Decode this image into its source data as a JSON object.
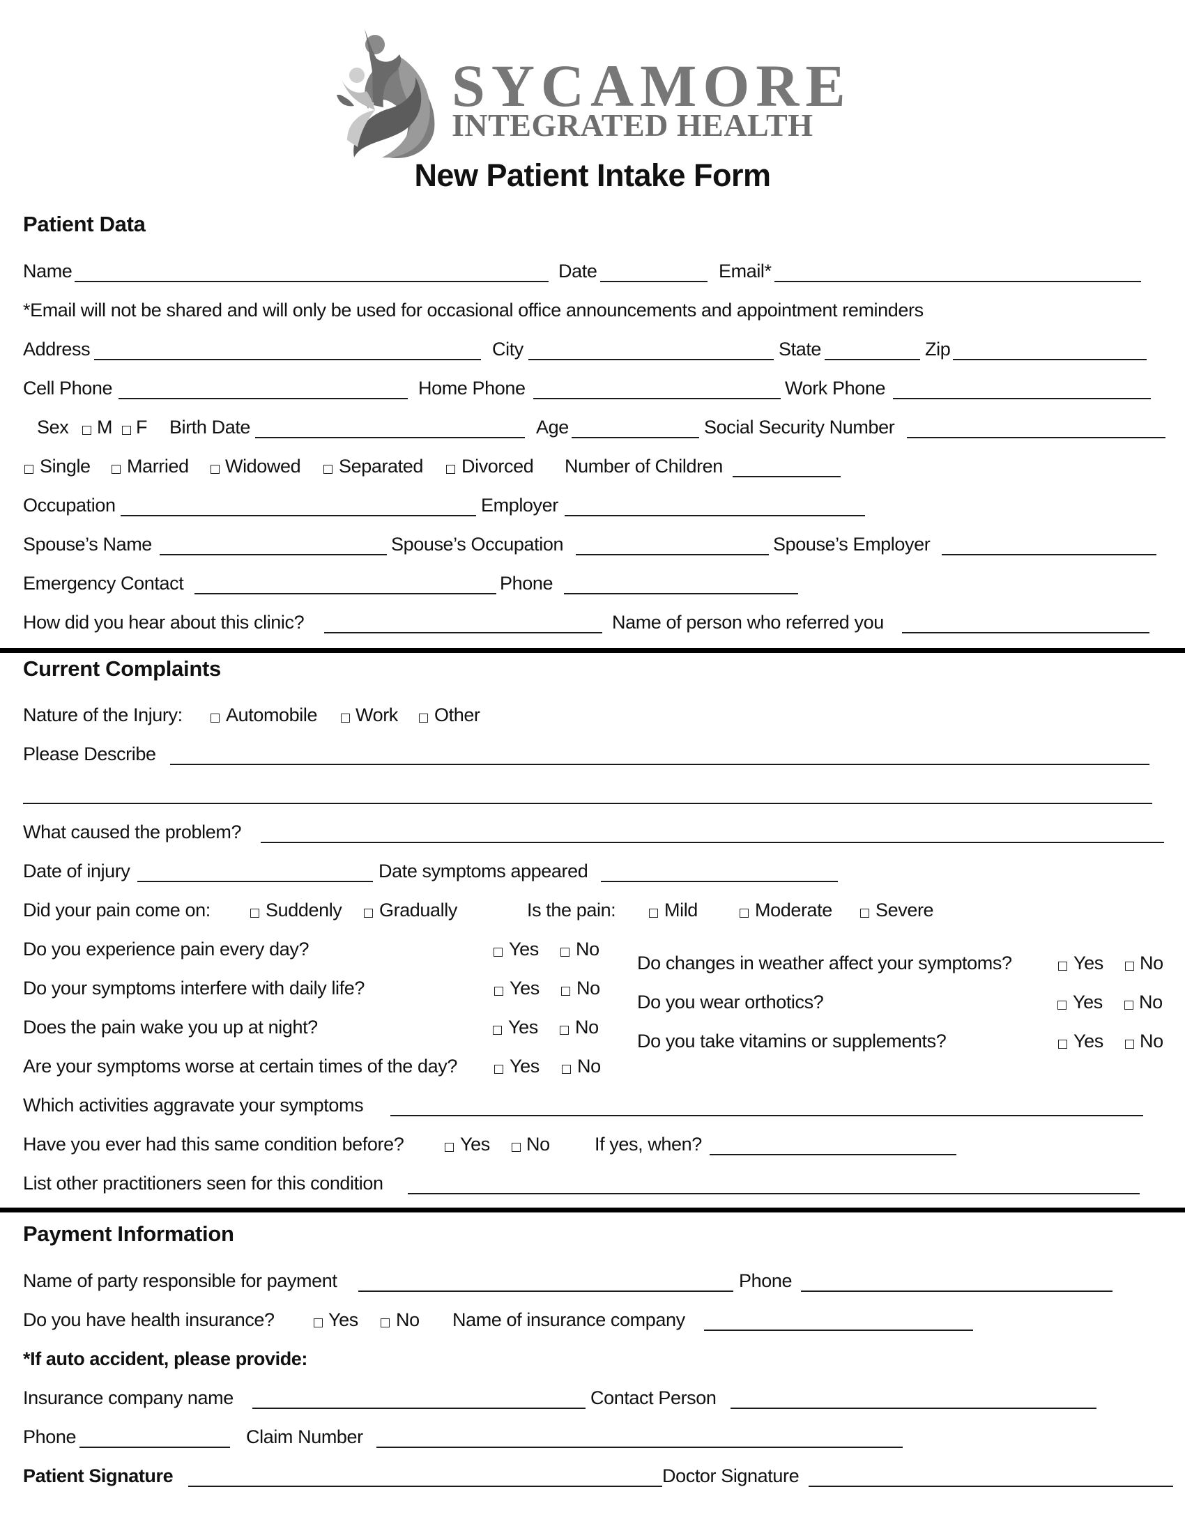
{
  "header": {
    "brand_line1": "SYCAMORE",
    "brand_line2": "INTEGRATED HEALTH",
    "logo_icon": "people-swoosh-logo",
    "form_title": "New Patient Intake Form"
  },
  "patient_data": {
    "heading": "Patient Data",
    "name_label": "Name",
    "date_label": "Date",
    "email_label": "Email*",
    "email_note": "*Email will not be shared and will only be used for occasional office announcements and appointment reminders",
    "address_label": "Address",
    "city_label": "City",
    "state_label": "State",
    "zip_label": "Zip",
    "cell_phone_label": "Cell Phone",
    "home_phone_label": "Home Phone",
    "work_phone_label": "Work Phone",
    "sex_label": "Sex",
    "sex_options": [
      "M",
      "F"
    ],
    "birth_date_label": "Birth Date",
    "age_label": "Age",
    "ssn_label": "Social Security Number",
    "marital_options": [
      "Single",
      "Married",
      "Widowed",
      "Separated",
      "Divorced"
    ],
    "children_label": "Number of Children",
    "occupation_label": "Occupation",
    "employer_label": "Employer",
    "spouse_name_label": "Spouse’s Name",
    "spouse_occupation_label": "Spouse’s Occupation",
    "spouse_employer_label": "Spouse’s Employer",
    "emergency_contact_label": "Emergency Contact",
    "emergency_phone_label": "Phone",
    "hear_about_label": "How did you hear about this clinic?",
    "referrer_label": "Name of person who referred you"
  },
  "current_complaints": {
    "heading": "Current Complaints",
    "nature_label": "Nature of the Injury:",
    "nature_options": [
      "Automobile",
      "Work",
      "Other"
    ],
    "describe_label": "Please Describe",
    "cause_label": "What caused the problem?",
    "date_injury_label": "Date of injury",
    "date_symptoms_label": "Date symptoms appeared",
    "onset_label": "Did your pain come on:",
    "onset_options": [
      "Suddenly",
      "Gradually"
    ],
    "severity_label": "Is the pain:",
    "severity_options": [
      "Mild",
      "Moderate",
      "Severe"
    ],
    "yes_label": "Yes",
    "no_label": "No",
    "left_questions": [
      "Do you experience pain every day?",
      "Do your symptoms interfere with daily life?",
      "Does the pain wake you up at night?",
      "Are your symptoms worse at certain times of the day?"
    ],
    "right_questions": [
      "Do changes in weather affect your symptoms?",
      "Do you wear orthotics?",
      "Do you take vitamins or supplements?"
    ],
    "aggravate_label": "Which activities aggravate your symptoms",
    "same_condition_label": "Have you ever had this same condition before?",
    "if_yes_label": "If yes, when?",
    "practitioners_label": "List other practitioners seen for this condition"
  },
  "payment": {
    "heading": "Payment Information",
    "responsible_label": "Name of party responsible for payment",
    "responsible_phone_label": "Phone",
    "insurance_question": "Do you have health insurance?",
    "insurance_company_label": "Name of insurance company",
    "auto_note": "*If auto accident, please provide:",
    "auto_insurance_label": "Insurance company name",
    "contact_person_label": "Contact Person",
    "auto_phone_label": "Phone",
    "claim_number_label": "Claim Number",
    "patient_signature_label": "Patient Signature",
    "doctor_signature_label": "Doctor Signature"
  }
}
